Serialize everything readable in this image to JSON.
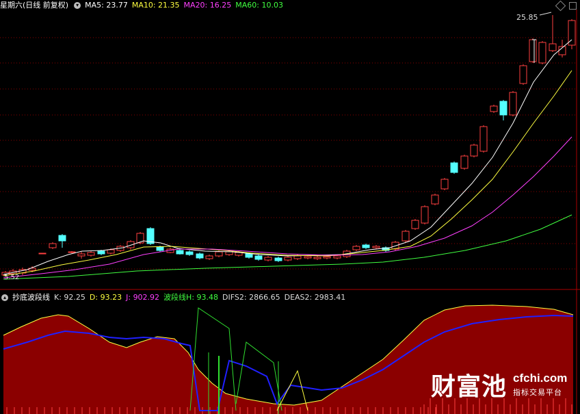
{
  "main": {
    "period": "星期六(日线 前复权)",
    "ma": [
      {
        "label": "MA5:",
        "value": "23.77",
        "color": "#ffffff"
      },
      {
        "label": "MA10:",
        "value": "21.35",
        "color": "#ffff40"
      },
      {
        "label": "MA20:",
        "value": "16.25",
        "color": "#ff40ff"
      },
      {
        "label": "MA60:",
        "value": "10.03",
        "color": "#40ff40"
      }
    ],
    "high_label": "25.85",
    "low_label": "5.52"
  },
  "sub": {
    "name": "抄底波段线",
    "indicators": [
      {
        "label": "K:",
        "value": "92.25",
        "color": "#dddddd"
      },
      {
        "label": "D:",
        "value": "93.23",
        "color": "#ffff40"
      },
      {
        "label": "J:",
        "value": "902.92",
        "color": "#ff40ff"
      },
      {
        "label": "波段线H:",
        "value": "93.48",
        "color": "#40ff40"
      },
      {
        "label": "DIFS2:",
        "value": "2866.65",
        "color": "#dddddd"
      },
      {
        "label": "DEAS2:",
        "value": "2983.41",
        "color": "#dddddd"
      }
    ]
  },
  "watermark": {
    "brand": "财富池",
    "site": "cfchi.com",
    "slogan": "指标交易平台"
  },
  "colors": {
    "up": "#ff4040",
    "down": "#54ffff",
    "grid": "#8b0000",
    "ma5": "#ffffff",
    "ma10": "#ffff40",
    "ma20": "#ff40ff",
    "ma60": "#40ff40",
    "area": "#8b0000",
    "blue": "#2020ff"
  }
}
